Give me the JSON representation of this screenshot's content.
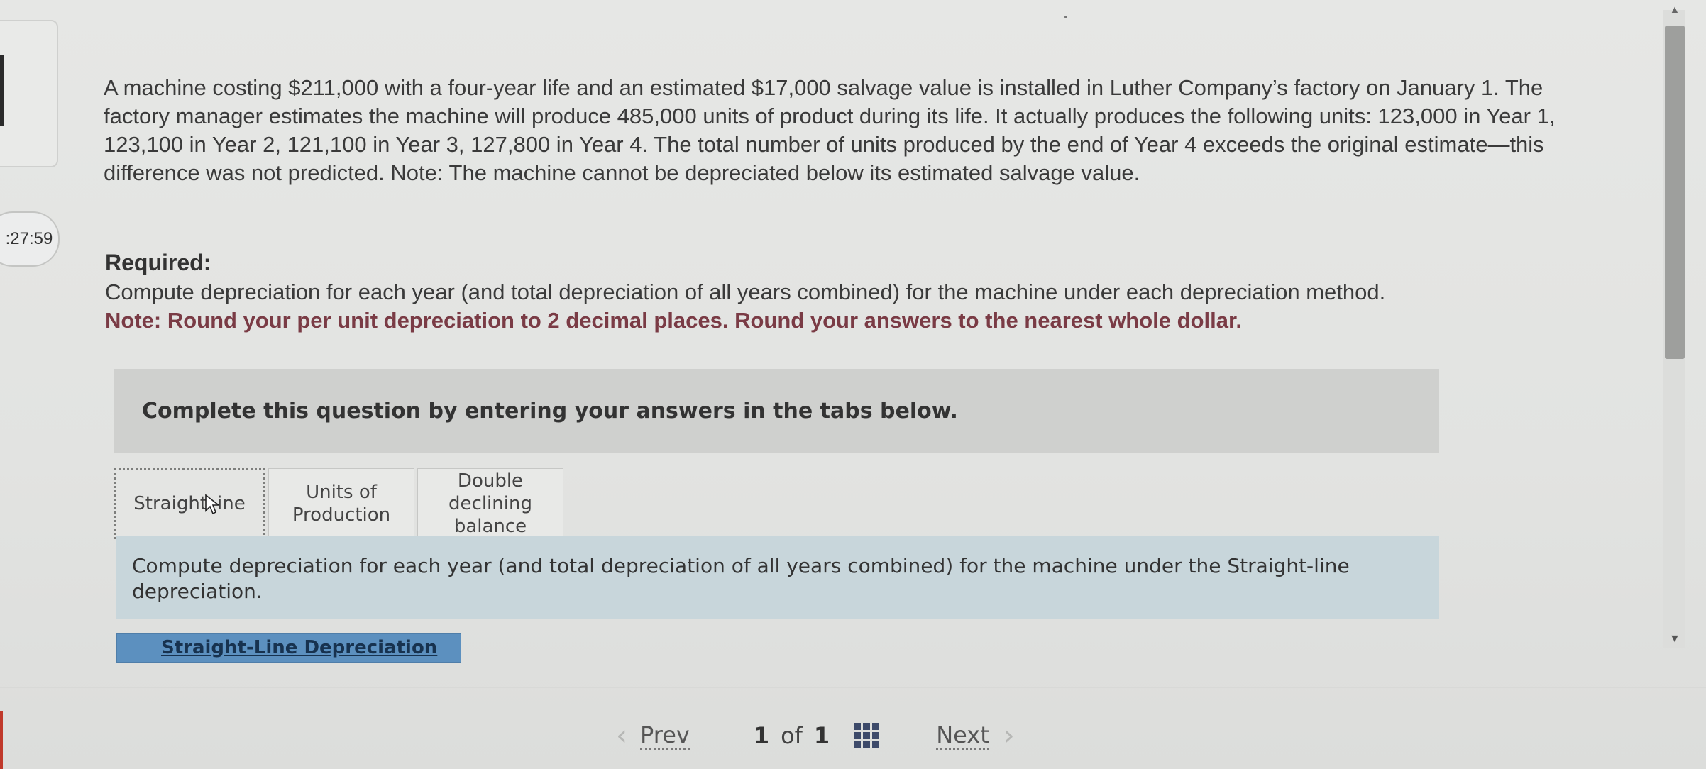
{
  "timer": {
    "text": ":27:59"
  },
  "question": {
    "text": "A machine costing $211,000 with a four-year life and an estimated $17,000 salvage value is installed in Luther Company’s factory on January 1. The factory manager estimates the machine will produce 485,000 units of product during its life. It actually produces the following units: 123,000 in Year 1, 123,100 in Year 2, 121,100 in Year 3, 127,800 in Year 4. The total number of units produced by the end of Year 4 exceeds the original estimate—this difference was not predicted. Note: The machine cannot be depreciated below its estimated salvage value."
  },
  "required": {
    "heading": "Required:",
    "text": "Compute depreciation for each year (and total depreciation of all years combined) for the machine under each depreciation method.",
    "note": "Note: Round your per unit depreciation to 2 decimal places. Round your answers to the nearest whole dollar."
  },
  "instructions": {
    "text": "Complete this question by entering your answers in the tabs below."
  },
  "tabs": [
    {
      "label_part1": "Straight",
      "label_part2": "ine",
      "active": true
    },
    {
      "line1": "Units of",
      "line2": "Production",
      "active": false
    },
    {
      "line1": "Double",
      "line2": "declining",
      "line3": "balance",
      "active": false
    }
  ],
  "content": {
    "text": "Compute depreciation for each year (and total depreciation of all years combined) for the machine under the Straight-line depreciation.",
    "subtab_label": "Straight-Line Depreciation"
  },
  "pager": {
    "prev_label": "Prev",
    "current": "1",
    "of": "of",
    "total": "1",
    "next_label": "Next"
  },
  "icons": {
    "prev": "chevron-left-icon",
    "next": "chevron-right-icon",
    "grid": "grid-icon",
    "cursor": "mouse-pointer-icon"
  },
  "colors": {
    "note": "#7a3b45",
    "content_bg": "#c8d6db",
    "subtab_bg": "#5c90bf",
    "grid_icon": "#3d4a6a"
  }
}
